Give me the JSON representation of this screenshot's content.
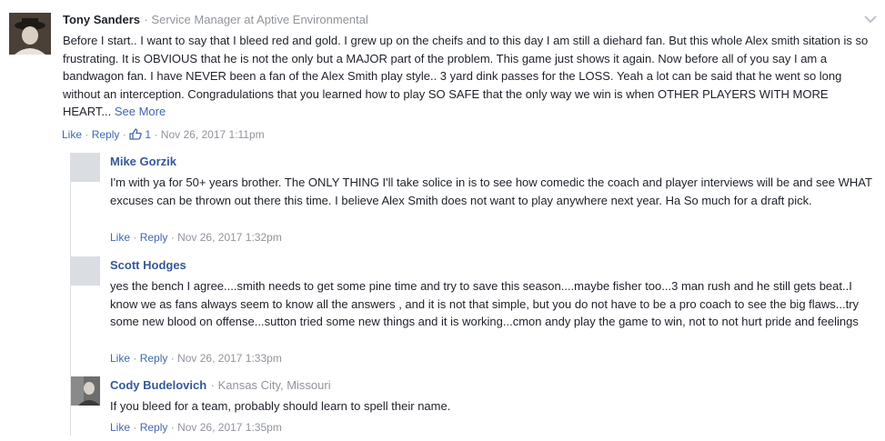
{
  "main_comment": {
    "author": "Tony Sanders",
    "title": "Service Manager at Aptive Environmental",
    "text": "Before I start.. I want to say that I bleed red and gold. I grew up on the cheifs and to this day I am still a diehard fan. But this whole Alex smith sitation is so frustrating. It is OBVIOUS that he is not the only but a MAJOR part of the problem. This game just shows it again. Now before all of you say I am a bandwagon fan. I have NEVER been a fan of the Alex Smith play style.. 3 yard dink passes for the LOSS. Yeah a lot can be said that he went so long without an interception. Congradulations that you learned how to play SO SAFE that the only way we win is when OTHER PLAYERS WITH MORE HEART...",
    "see_more": "See More",
    "like_label": "Like",
    "reply_label": "Reply",
    "like_count": "1",
    "timestamp": "Nov 26, 2017 1:11pm",
    "colors": {
      "link": "#4267b2",
      "name": "#1d2129",
      "muted": "#90949c"
    }
  },
  "replies": [
    {
      "author": "Mike Gorzik",
      "text": "I'm with ya for 50+ years brother. The ONLY THING I'll take solice in is to see how comedic the coach and player interviews will be and see WHAT excuses can be thrown out there this time. I believe Alex Smith does not want to play anywhere next year. Ha So much for a draft pick.",
      "like_label": "Like",
      "reply_label": "Reply",
      "timestamp": "Nov 26, 2017 1:32pm"
    },
    {
      "author": "Scott Hodges",
      "text": "yes the bench I agree....smith needs to get some pine time and try to save this season....maybe fisher too...3 man rush and he still gets beat..I know we as fans always seem to know all the answers , and it is not that simple, but you do not have to be a pro coach to see the big flaws...try some new blood on offense...sutton tried some new things and it is working...cmon andy play the game to win, not to not hurt pride and feelings",
      "like_label": "Like",
      "reply_label": "Reply",
      "timestamp": "Nov 26, 2017 1:33pm"
    },
    {
      "author": "Cody Budelovich",
      "location": "Kansas City, Missouri",
      "text": "If you bleed for a team, probably should learn to spell their name.",
      "like_label": "Like",
      "reply_label": "Reply",
      "timestamp": "Nov 26, 2017 1:35pm"
    }
  ]
}
